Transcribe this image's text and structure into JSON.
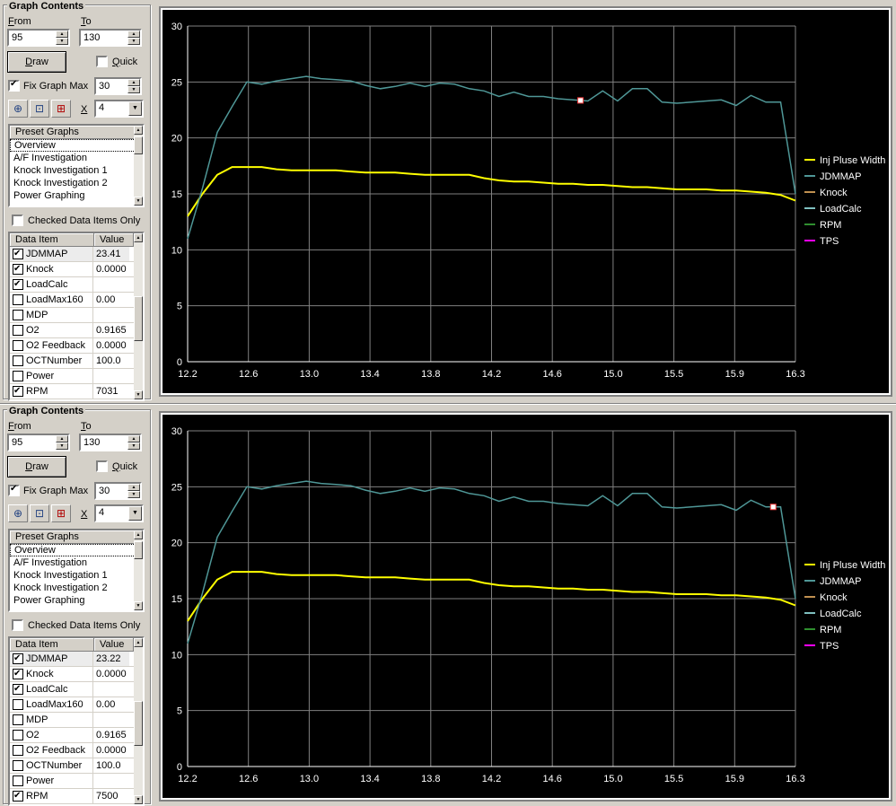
{
  "panes": [
    {
      "group_title": "Graph Contents",
      "from_label": "From",
      "to_label": "To",
      "from_value": "95",
      "to_value": "130",
      "draw_label": "Draw",
      "quick_label": "Quick",
      "quick_checked": false,
      "fixmax_label": "Fix Graph Max",
      "fixmax_checked": true,
      "fixmax_value": "30",
      "x_label": "X",
      "x_value": "4",
      "preset_header": "Preset Graphs",
      "presets": [
        "Overview",
        "A/F Investigation",
        "Knock Investigation 1",
        "Knock Investigation 2",
        "Power Graphing"
      ],
      "checked_only_label": "Checked Data Items Only",
      "checked_only": false,
      "data_header": [
        "Data Item",
        "Value"
      ],
      "data_items": [
        {
          "name": "JDMMAP",
          "value": "23.41",
          "checked": true
        },
        {
          "name": "Knock",
          "value": "0.0000",
          "checked": true
        },
        {
          "name": "LoadCalc",
          "value": "",
          "checked": true
        },
        {
          "name": "LoadMax160",
          "value": "0.00",
          "checked": false
        },
        {
          "name": "MDP",
          "value": "",
          "checked": false
        },
        {
          "name": "O2",
          "value": "0.9165",
          "checked": false
        },
        {
          "name": "O2 Feedback",
          "value": "0.0000",
          "checked": false
        },
        {
          "name": "OCTNumber",
          "value": "100.0",
          "checked": false
        },
        {
          "name": "Power",
          "value": "",
          "checked": false
        },
        {
          "name": "RPM",
          "value": "7031",
          "checked": true
        }
      ],
      "cursor_x": 14.85
    },
    {
      "group_title": "Graph Contents",
      "from_label": "From",
      "to_label": "To",
      "from_value": "95",
      "to_value": "130",
      "draw_label": "Draw",
      "quick_label": "Quick",
      "quick_checked": false,
      "fixmax_label": "Fix Graph Max",
      "fixmax_checked": true,
      "fixmax_value": "30",
      "x_label": "X",
      "x_value": "4",
      "preset_header": "Preset Graphs",
      "presets": [
        "Overview",
        "A/F Investigation",
        "Knock Investigation 1",
        "Knock Investigation 2",
        "Power Graphing"
      ],
      "checked_only_label": "Checked Data Items Only",
      "checked_only": false,
      "data_header": [
        "Data Item",
        "Value"
      ],
      "data_items": [
        {
          "name": "JDMMAP",
          "value": "23.22",
          "checked": true
        },
        {
          "name": "Knock",
          "value": "0.0000",
          "checked": true
        },
        {
          "name": "LoadCalc",
          "value": "",
          "checked": true
        },
        {
          "name": "LoadMax160",
          "value": "0.00",
          "checked": false
        },
        {
          "name": "MDP",
          "value": "",
          "checked": false
        },
        {
          "name": "O2",
          "value": "0.9165",
          "checked": false
        },
        {
          "name": "O2 Feedback",
          "value": "0.0000",
          "checked": false
        },
        {
          "name": "OCTNumber",
          "value": "100.0",
          "checked": false
        },
        {
          "name": "Power",
          "value": "",
          "checked": false
        },
        {
          "name": "RPM",
          "value": "7500",
          "checked": true
        }
      ],
      "cursor_x": 16.15
    }
  ],
  "chart_data": {
    "type": "line",
    "xlim": [
      12.2,
      16.3
    ],
    "ylim": [
      0,
      30
    ],
    "x_ticks": [
      "12.2",
      "12.6",
      "13.0",
      "13.4",
      "13.8",
      "14.2",
      "14.6",
      "15.0",
      "15.5",
      "15.9",
      "16.3"
    ],
    "y_ticks": [
      "0",
      "5",
      "10",
      "15",
      "20",
      "25",
      "30"
    ],
    "grid": true,
    "legend_position": "right",
    "background": "#000000",
    "grid_color": "#808080",
    "series": [
      {
        "name": "Inj Pluse Width",
        "color": "#ffff00",
        "x": [
          12.2,
          12.3,
          12.4,
          12.5,
          12.6,
          12.7,
          12.8,
          12.9,
          13.0,
          13.1,
          13.2,
          13.3,
          13.4,
          13.5,
          13.6,
          13.7,
          13.8,
          13.9,
          14.0,
          14.1,
          14.2,
          14.3,
          14.4,
          14.5,
          14.6,
          14.7,
          14.8,
          14.9,
          15.0,
          15.1,
          15.2,
          15.3,
          15.4,
          15.5,
          15.6,
          15.7,
          15.8,
          15.9,
          16.0,
          16.1,
          16.2,
          16.3
        ],
        "y": [
          13.0,
          15.0,
          16.7,
          17.4,
          17.4,
          17.4,
          17.2,
          17.1,
          17.1,
          17.1,
          17.1,
          17.0,
          16.9,
          16.9,
          16.9,
          16.8,
          16.7,
          16.7,
          16.7,
          16.7,
          16.4,
          16.2,
          16.1,
          16.1,
          16.0,
          15.9,
          15.9,
          15.8,
          15.8,
          15.7,
          15.6,
          15.6,
          15.5,
          15.4,
          15.4,
          15.4,
          15.3,
          15.3,
          15.2,
          15.1,
          14.9,
          14.4
        ]
      },
      {
        "name": "JDMMAP",
        "color": "#4f9797",
        "x": [
          12.2,
          12.3,
          12.4,
          12.5,
          12.6,
          12.7,
          12.8,
          12.9,
          13.0,
          13.1,
          13.2,
          13.3,
          13.4,
          13.5,
          13.6,
          13.7,
          13.8,
          13.9,
          14.0,
          14.1,
          14.2,
          14.3,
          14.4,
          14.5,
          14.6,
          14.7,
          14.8,
          14.9,
          15.0,
          15.1,
          15.2,
          15.3,
          15.4,
          15.5,
          15.6,
          15.7,
          15.8,
          15.9,
          16.0,
          16.1,
          16.2,
          16.3
        ],
        "y": [
          11.0,
          15.5,
          20.5,
          22.8,
          25.0,
          24.8,
          25.1,
          25.3,
          25.5,
          25.3,
          25.2,
          25.1,
          24.7,
          24.4,
          24.6,
          24.9,
          24.6,
          24.9,
          24.8,
          24.4,
          24.2,
          23.7,
          24.1,
          23.7,
          23.7,
          23.5,
          23.4,
          23.3,
          24.2,
          23.3,
          24.4,
          24.4,
          23.2,
          23.1,
          23.2,
          23.3,
          23.4,
          22.9,
          23.8,
          23.2,
          23.2,
          15.0
        ]
      },
      {
        "name": "Knock",
        "color": "#c09050",
        "x": [],
        "y": []
      },
      {
        "name": "LoadCalc",
        "color": "#7fc0c0",
        "x": [],
        "y": []
      },
      {
        "name": "RPM",
        "color": "#2f8f2f",
        "x": [],
        "y": []
      },
      {
        "name": "TPS",
        "color": "#ff00ff",
        "x": [],
        "y": []
      }
    ]
  }
}
